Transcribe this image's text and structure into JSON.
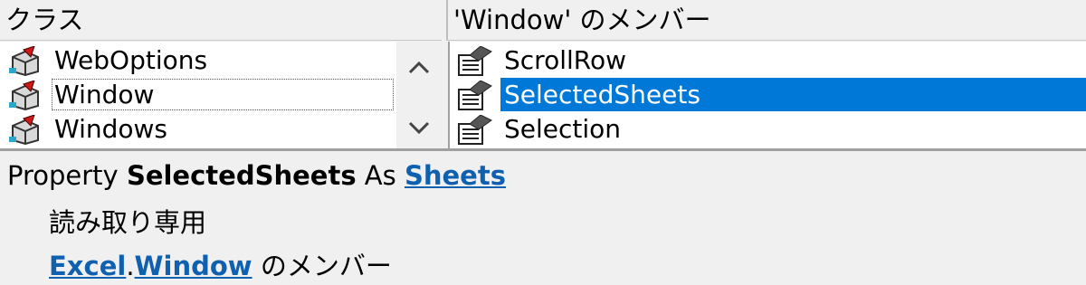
{
  "classes": {
    "header": "クラス",
    "items": [
      {
        "label": "WebOptions",
        "icon": "class-icon"
      },
      {
        "label": "Window",
        "icon": "class-icon"
      },
      {
        "label": "Windows",
        "icon": "class-icon"
      }
    ]
  },
  "members": {
    "header": "'Window' のメンバー",
    "items": [
      {
        "label": "ScrollRow",
        "icon": "property-icon"
      },
      {
        "label": "SelectedSheets",
        "icon": "property-icon"
      },
      {
        "label": "Selection",
        "icon": "property-icon"
      }
    ]
  },
  "details": {
    "prefix": "Property",
    "name": "SelectedSheets",
    "as_word": "As",
    "type_link": "Sheets",
    "access": "読み取り専用",
    "library_link": "Excel",
    "dot": ".",
    "class_link": "Window",
    "member_of": "のメンバー"
  },
  "colors": {
    "selection": "#0078d7",
    "link": "#1060b0"
  }
}
